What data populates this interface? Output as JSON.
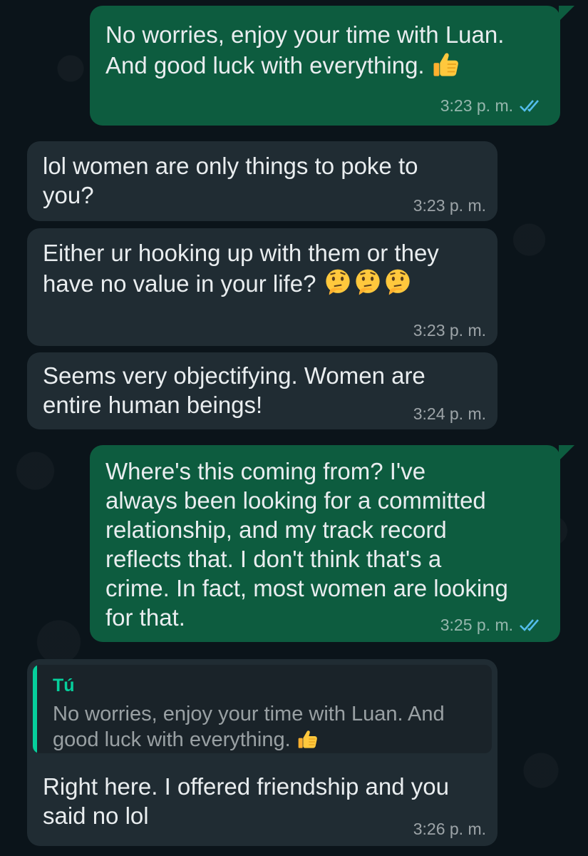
{
  "theme": {
    "background": "#0b141a",
    "outgoing_bubble": "#0d5c3f",
    "incoming_bubble": "#202c33",
    "tick_color": "#53bdeb",
    "quote_accent": "#06cf9c"
  },
  "messages": [
    {
      "direction": "outgoing",
      "text": "No worries, enjoy your time with Luan.\nAnd good luck with everything.",
      "emoji": "thumbs-up",
      "time": "3:23 p. m.",
      "status": "read"
    },
    {
      "direction": "incoming",
      "text": "lol women are only things to poke to\nyou?",
      "time": "3:23 p. m."
    },
    {
      "direction": "incoming",
      "text": "Either ur hooking up with them or they\nhave no value in your life?",
      "emoji": "thinking-face x3",
      "time": "3:23 p. m."
    },
    {
      "direction": "incoming",
      "text": "Seems very objectifying. Women are\nentire human beings!",
      "time": "3:24 p. m."
    },
    {
      "direction": "outgoing",
      "text": "Where's this coming from? I've\nalways been looking for a committed\nrelationship, and my track record\nreflects that. I don't think that's a\ncrime. In fact, most women are looking\nfor that.",
      "time": "3:25 p. m.",
      "status": "read"
    },
    {
      "direction": "incoming",
      "quote": {
        "author": "Tú",
        "text": "No worries, enjoy your time with Luan. And\ngood luck with everything.",
        "emoji": "thumbs-up"
      },
      "text": "Right here. I offered friendship and you\nsaid no lol",
      "time": "3:26 p. m."
    }
  ]
}
